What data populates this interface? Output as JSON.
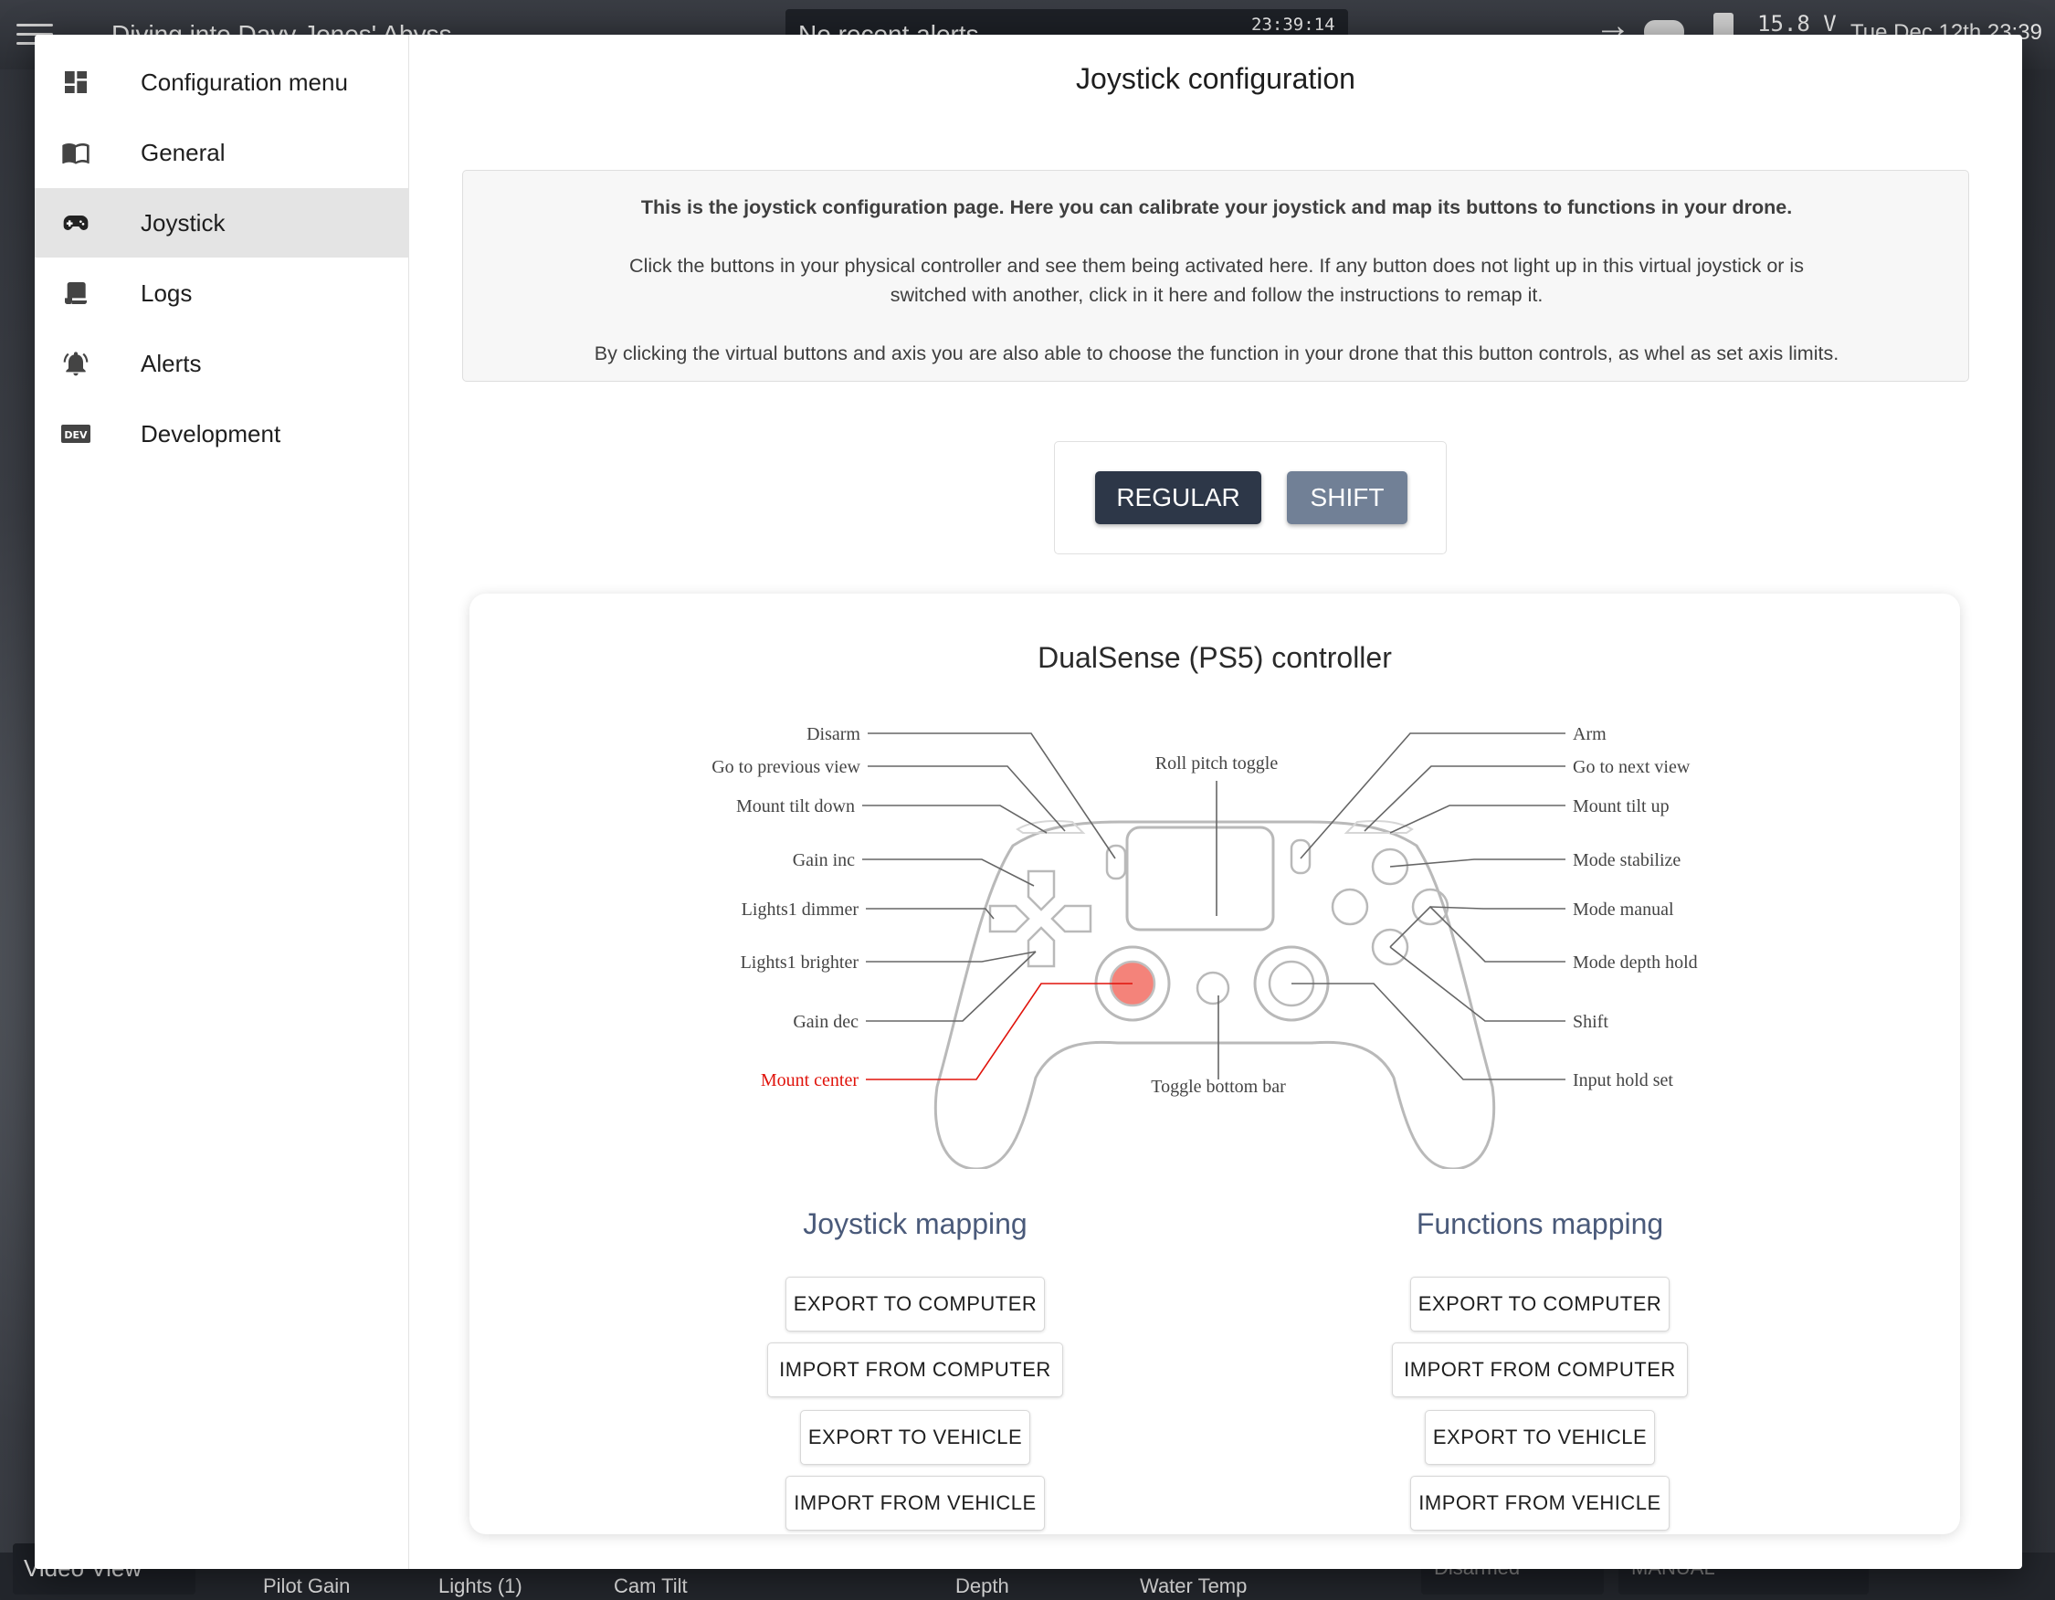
{
  "background": {
    "mission_name": "Diving into Davy Jones' Abyss",
    "alert_text": "No recent alerts",
    "alert_time": "23:39:14",
    "voltage": "15.8 V",
    "datetime": "Tue Dec 12th 23:39",
    "view_label": "Video View",
    "widgets": [
      "Pilot Gain",
      "Lights (1)",
      "Cam Tilt",
      "Depth",
      "Water Temp"
    ],
    "arm_state": "Disarmed",
    "flight_mode": "MANUAL"
  },
  "sidebar": {
    "items": [
      {
        "label": "Configuration menu",
        "icon": "dashboard-icon"
      },
      {
        "label": "General",
        "icon": "book-icon"
      },
      {
        "label": "Joystick",
        "icon": "gamepad-icon",
        "active": true
      },
      {
        "label": "Logs",
        "icon": "scroll-icon"
      },
      {
        "label": "Alerts",
        "icon": "bell-icon"
      },
      {
        "label": "Development",
        "icon": "dev-icon"
      }
    ]
  },
  "main": {
    "title": "Joystick configuration",
    "info": {
      "line1": "This is the joystick configuration page. Here you can calibrate your joystick and map its buttons to functions in your drone.",
      "line2a": "Click the buttons in your physical controller and see them being activated here. If any button does not light up in this virtual joystick or is",
      "line2b": "switched with another, click in it here and follow the instructions to remap it.",
      "line3": "By clicking the virtual buttons and axis you are also able to choose the function in your drone that this button controls, as whel as set axis limits."
    },
    "modes": {
      "regular": "REGULAR",
      "shift": "SHIFT",
      "active": "REGULAR"
    },
    "controller": {
      "title": "DualSense (PS5) controller",
      "left_labels": {
        "disarm": "Disarm",
        "prev_view": "Go to previous view",
        "tilt_down": "Mount tilt down",
        "gain_inc": "Gain inc",
        "lights_dimmer": "Lights1 dimmer",
        "lights_brighter": "Lights1 brighter",
        "gain_dec": "Gain dec",
        "mount_center": "Mount center"
      },
      "right_labels": {
        "arm": "Arm",
        "next_view": "Go to next view",
        "tilt_up": "Mount tilt up",
        "stabilize": "Mode stabilize",
        "manual": "Mode manual",
        "depth_hold": "Mode depth hold",
        "shift": "Shift",
        "input_hold": "Input hold set"
      },
      "center_labels": {
        "roll_pitch": "Roll pitch toggle",
        "bottom_bar": "Toggle bottom bar"
      },
      "highlight_color": "#f4837a",
      "highlight_label_color": "#e0130b"
    },
    "joystick_mapping": {
      "title": "Joystick mapping",
      "export_computer": "EXPORT TO COMPUTER",
      "import_computer": "IMPORT FROM COMPUTER",
      "export_vehicle": "EXPORT TO VEHICLE",
      "import_vehicle": "IMPORT FROM VEHICLE"
    },
    "functions_mapping": {
      "title": "Functions mapping",
      "export_computer": "EXPORT TO COMPUTER",
      "import_computer": "IMPORT FROM COMPUTER",
      "export_vehicle": "EXPORT TO VEHICLE",
      "import_vehicle": "IMPORT FROM VEHICLE"
    }
  }
}
